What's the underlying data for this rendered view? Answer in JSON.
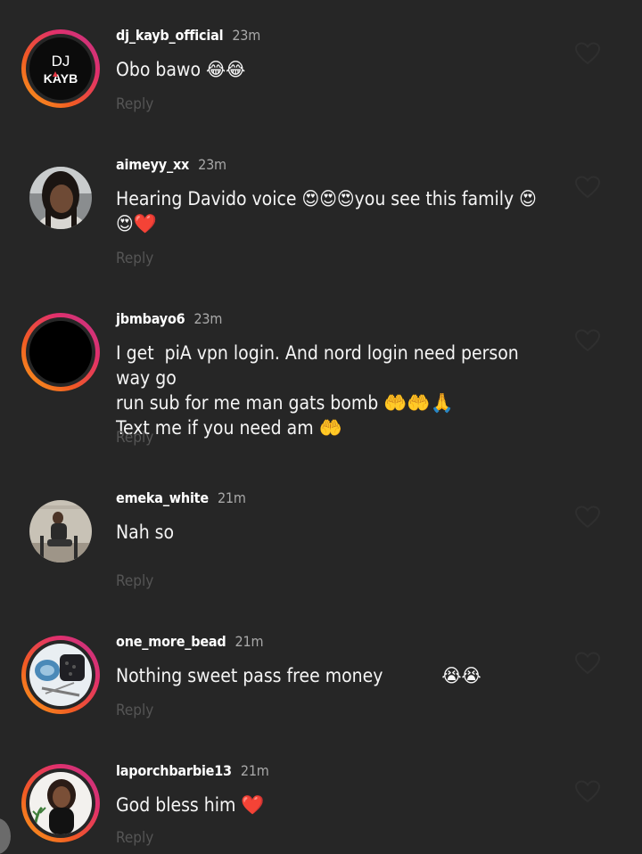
{
  "comments": [
    {
      "username": "dj_kayb_official",
      "time": "23m",
      "text": "Obo bawo 😂😂",
      "reply": "Reply",
      "avatar": {
        "type": "logo",
        "line1": "DJ",
        "line2": "KAYB"
      },
      "has_story": true
    },
    {
      "username": "aimeyy_xx",
      "time": "23m",
      "text": "Hearing Davido voice 😍😍😍you see this family 😍\n😍❤️",
      "reply": "Reply",
      "avatar": {
        "type": "photo"
      },
      "has_story": false
    },
    {
      "username": "jbmbayo6",
      "time": "23m",
      "text": "I get  piA vpn login. And nord login need person way go\nrun sub for me man gats bomb 🤲🤲🙏\nText me if you need am 🤲",
      "reply": "Reply",
      "avatar": {
        "type": "black"
      },
      "has_story": true
    },
    {
      "username": "emeka_white",
      "time": "21m",
      "text": "Nah so",
      "reply": "Reply",
      "avatar": {
        "type": "photo"
      },
      "has_story": false
    },
    {
      "username": "one_more_bead",
      "time": "21m",
      "text": "Nothing sweet pass free money           😭😭",
      "reply": "Reply",
      "avatar": {
        "type": "photo"
      },
      "has_story": true
    },
    {
      "username": "laporchbarbie13",
      "time": "21m",
      "text": "God bless him ❤️",
      "reply": "Reply",
      "avatar": {
        "type": "photo"
      },
      "has_story": true
    }
  ],
  "icons": {
    "like": "heart-icon"
  },
  "colors": {
    "background": "#262626",
    "story_ring": [
      "#f9a11b",
      "#e1306c",
      "#c13584"
    ],
    "muted": "#a8a8a8"
  }
}
